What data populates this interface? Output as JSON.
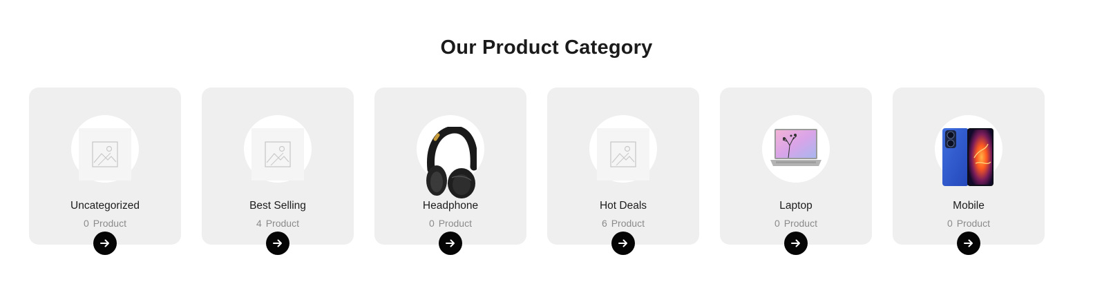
{
  "section": {
    "title": "Our Product Category"
  },
  "categories": [
    {
      "name": "Uncategorized",
      "count": "0",
      "count_label": "Product",
      "image": "placeholder-image-icon"
    },
    {
      "name": "Best Selling",
      "count": "4",
      "count_label": "Product",
      "image": "placeholder-image-icon"
    },
    {
      "name": "Headphone",
      "count": "0",
      "count_label": "Product",
      "image": "headphone-image"
    },
    {
      "name": "Hot Deals",
      "count": "6",
      "count_label": "Product",
      "image": "placeholder-image-icon"
    },
    {
      "name": "Laptop",
      "count": "0",
      "count_label": "Product",
      "image": "laptop-image"
    },
    {
      "name": "Mobile",
      "count": "0",
      "count_label": "Product",
      "image": "mobile-image"
    }
  ],
  "button": {
    "icon": "arrow-right-icon"
  },
  "colors": {
    "card_bg": "#efefef",
    "button_bg": "#050505",
    "title": "#1b1b1b",
    "count_text": "#8a8a8a"
  }
}
